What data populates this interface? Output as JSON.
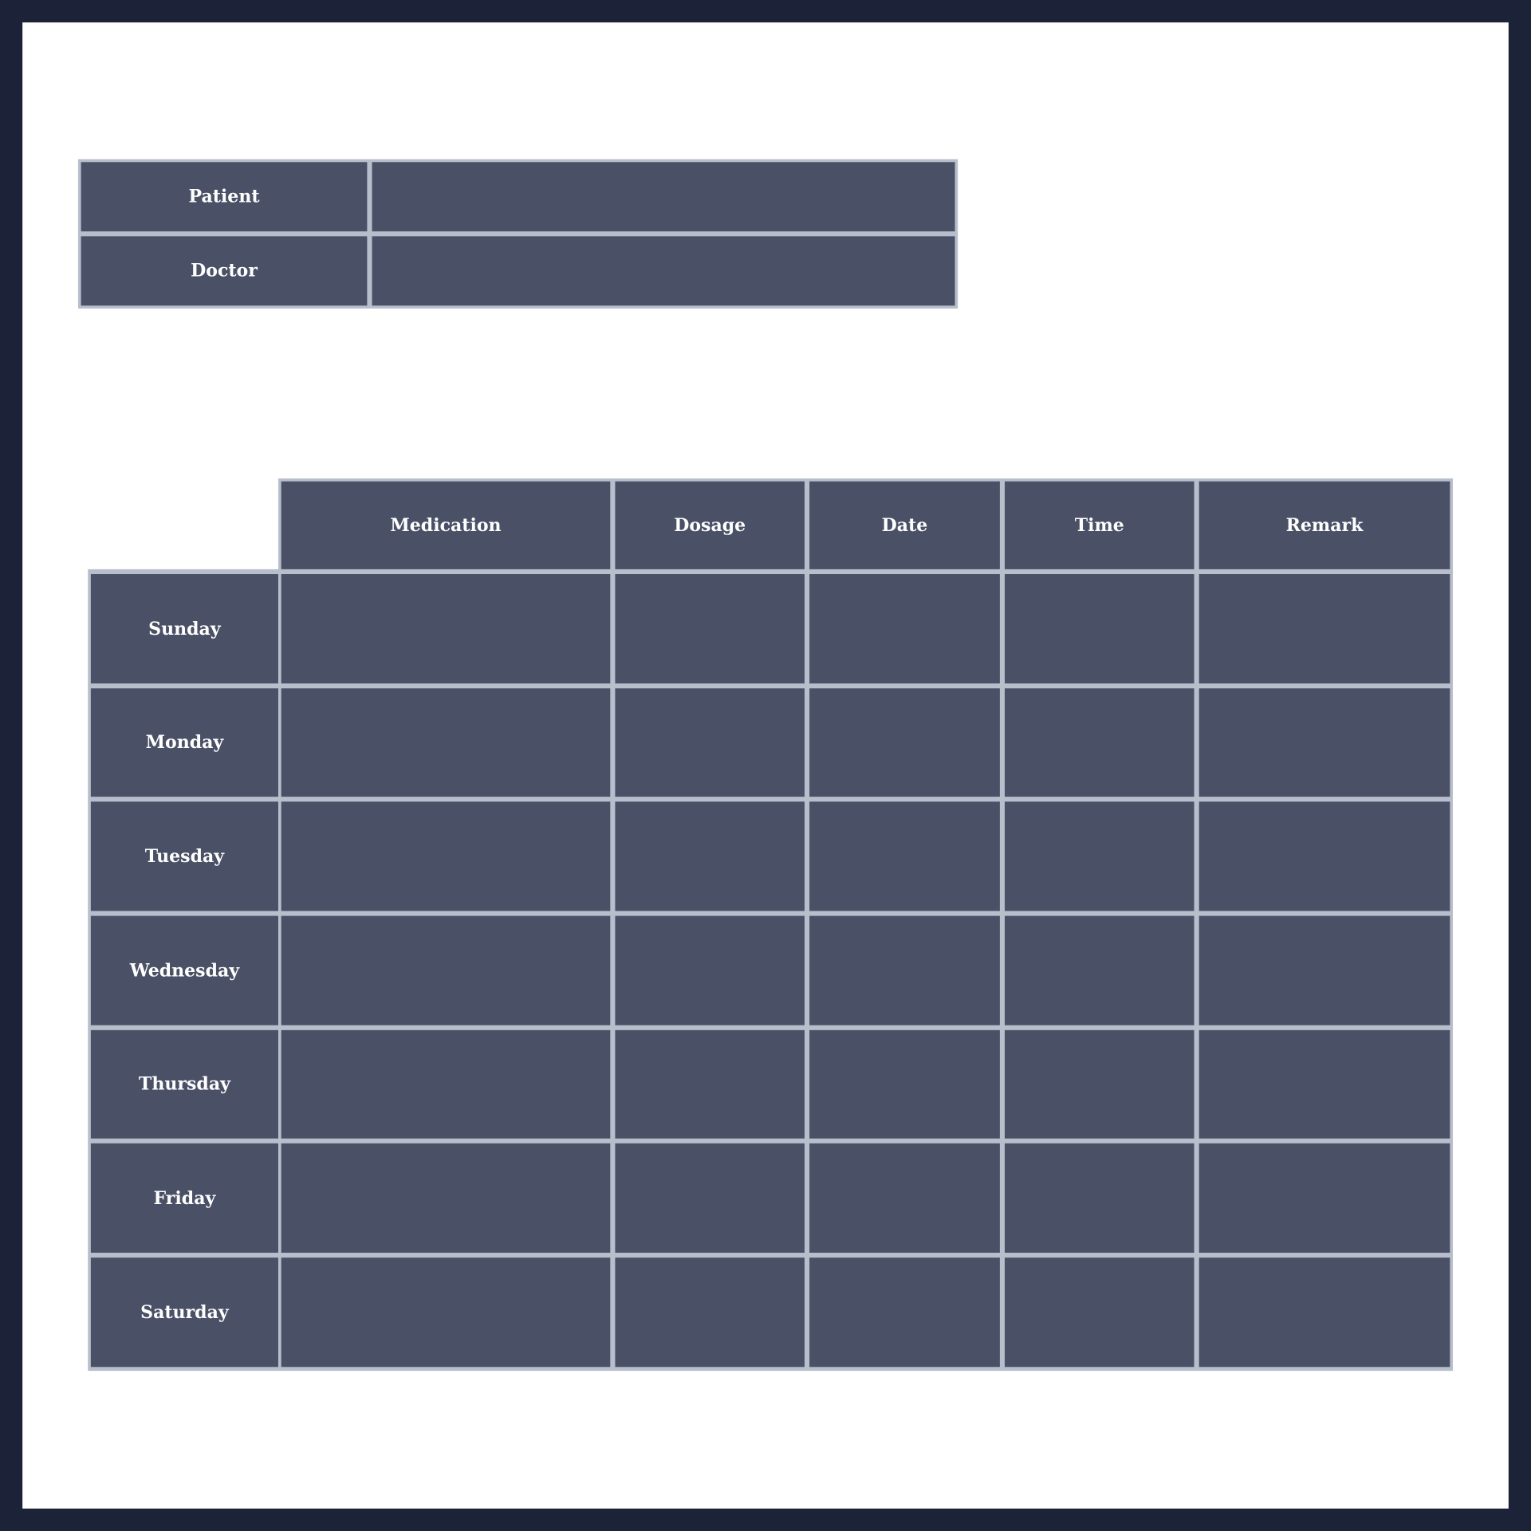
{
  "info_table": {
    "rows": [
      {
        "label": "Patient",
        "value": ""
      },
      {
        "label": "Doctor",
        "value": ""
      }
    ]
  },
  "schedule": {
    "columns": [
      "Medication",
      "Dosage",
      "Date",
      "Time",
      "Remark"
    ],
    "days": [
      "Sunday",
      "Monday",
      "Tuesday",
      "Wednesday",
      "Thursday",
      "Friday",
      "Saturday"
    ]
  },
  "colors": {
    "frame": "#1c2237",
    "cell": "#4a5166",
    "grid": "#b8bfcc",
    "text": "#ffffff"
  }
}
